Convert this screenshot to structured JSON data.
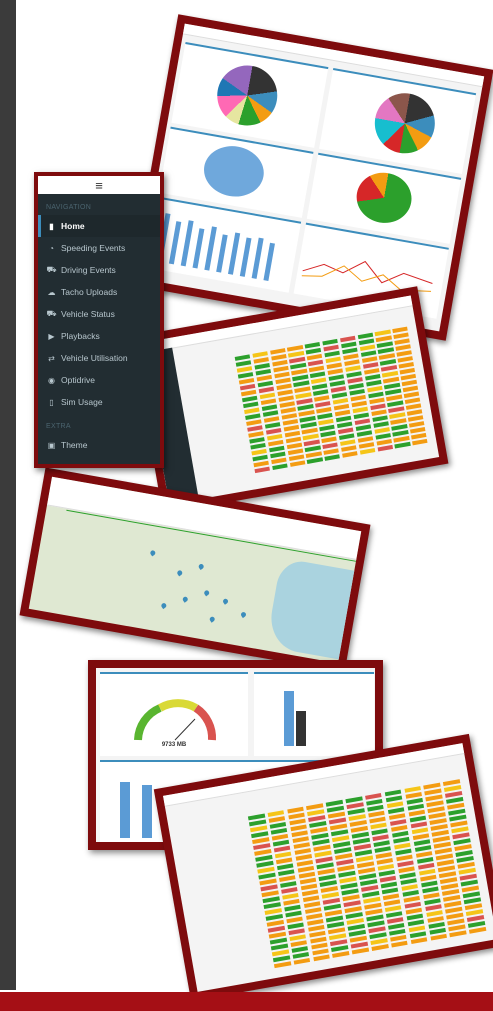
{
  "sidebar": {
    "menu_glyph": "≡",
    "nav_header": "NAVIGATION",
    "extra_header": "EXTRA",
    "items": [
      {
        "label": "Home",
        "icon": "bar-chart-icon",
        "active": true
      },
      {
        "label": "Speeding Events",
        "icon": "tachometer-icon"
      },
      {
        "label": "Driving Events",
        "icon": "car-icon"
      },
      {
        "label": "Tacho Uploads",
        "icon": "cloud-upload-icon"
      },
      {
        "label": "Vehicle Status",
        "icon": "car-status-icon"
      },
      {
        "label": "Playbacks",
        "icon": "play-icon"
      },
      {
        "label": "Vehicle Utilisation",
        "icon": "exchange-icon"
      },
      {
        "label": "Optidrive",
        "icon": "eye-icon"
      },
      {
        "label": "Sim Usage",
        "icon": "mobile-icon"
      }
    ],
    "extra_items": [
      {
        "label": "Theme",
        "icon": "picture-icon"
      }
    ]
  },
  "gauge": {
    "value_text": "9733 MB"
  },
  "colors": {
    "frame": "#7e0b0d",
    "accent": "#3c8dbc",
    "bottom_bar": "#a50f15",
    "sidebar_bg": "#222d32"
  }
}
